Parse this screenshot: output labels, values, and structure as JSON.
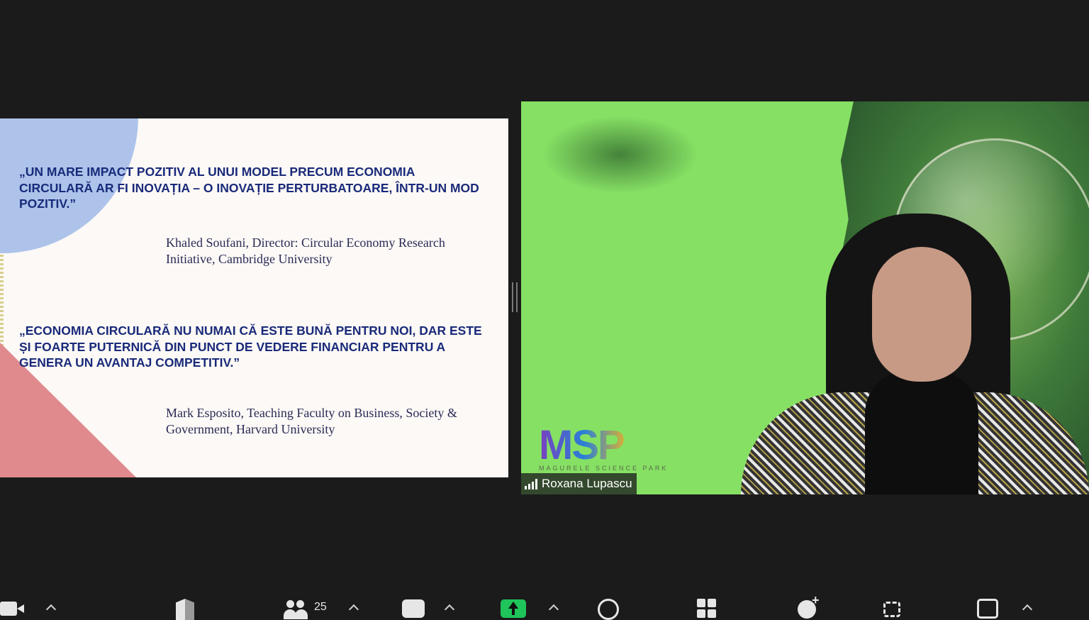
{
  "slide": {
    "quote1": "„UN MARE IMPACT POZITIV AL UNUI MODEL PRECUM ECONOMIA CIRCULARĂ AR FI INOVAȚIA – O INOVAȚIE PERTURBATOARE, ÎNTR-UN MOD POZITIV.”",
    "attribution1": "Khaled Soufani, Director: Circular Economy Research Initiative, Cambridge University",
    "quote2": "„ECONOMIA CIRCULARĂ NU NUMAI CĂ ESTE BUNĂ PENTRU NOI, DAR ESTE ȘI FOARTE PUTERNICĂ DIN PUNCT DE VEDERE FINANCIAR PENTRU A GENERA UN AVANTAJ COMPETITIV.”",
    "attribution2": "Mark Esposito, Teaching Faculty on Business, Society & Government, Harvard University",
    "colors": {
      "quote_text": "#1a2a7a",
      "blue_circle": "#adc3ea",
      "pink_triangle": "#e08a8e"
    }
  },
  "video": {
    "participant_name": "Roxana Lupascu",
    "logo_text": "MSP",
    "logo_subtext": "MAGURELE SCIENCE PARK",
    "background_color": "#86e064",
    "signal_icon": "signal-strength-icon"
  },
  "toolbar": {
    "participants_count": "25",
    "icons": [
      "video-camera-icon",
      "security-shield-icon",
      "participants-icon",
      "chat-icon",
      "share-screen-icon",
      "record-icon",
      "apps-icon",
      "reactions-icon",
      "whiteboard-icon",
      "more-icon"
    ],
    "share_color": "#1fc45a"
  }
}
